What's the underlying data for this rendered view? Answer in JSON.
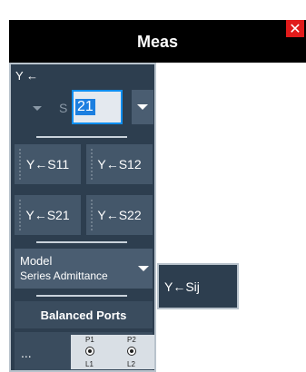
{
  "dialog": {
    "title": "Meas",
    "close_icon_char": "✕"
  },
  "panel": {
    "section_label": "Y ←",
    "s_label": "S",
    "input_value": "21",
    "buttons": [
      "Y←S11",
      "Y←S12",
      "Y←S21",
      "Y←S22"
    ],
    "model": {
      "title": "Model",
      "value": "Series Admittance"
    },
    "balanced_ports_label": "Balanced Ports",
    "ports_ellipsis": "...",
    "port_diagram": {
      "p1": "P1",
      "p2": "P2",
      "l1": "L1",
      "l2": "L2"
    }
  },
  "submenu": {
    "sij_label": "Y←Sij"
  },
  "colors": {
    "title_bar": "#000000",
    "panel": "#2d3e4f",
    "button": "#44576a",
    "accent_input": "#0e8ef0",
    "close": "#e11b1b"
  }
}
